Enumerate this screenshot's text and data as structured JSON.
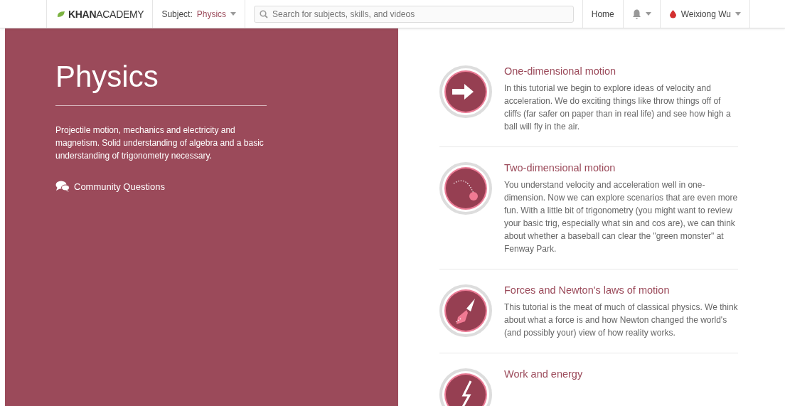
{
  "header": {
    "logo": "**KHAN**ACADEMY",
    "subject_label": "Subject:",
    "subject_value": "Physics",
    "search": {
      "placeholder": "Search for subjects, skills, and videos"
    },
    "home": "Home",
    "user": "Weixiong Wu"
  },
  "hero": {
    "title": "Physics",
    "description": "Projectile motion, mechanics and electricity and magnetism. Solid understanding of algebra and a basic understanding of trigonometry necessary.",
    "community_link": "Community Questions"
  },
  "tutorials": [
    {
      "kind": "arrow",
      "title": "One-dimensional motion",
      "description": "In this tutorial we begin to explore ideas of velocity and acceleration. We do exciting things like throw things off of cliffs (far safer on paper than in real life) and see how high a ball will fly in the air."
    },
    {
      "kind": "trajectory",
      "title": "Two-dimensional motion",
      "description": "You understand velocity and acceleration well in one-dimension. Now we can explore scenarios that are even more fun. With a little bit of trigonometry (you might want to review your basic trig, especially what sin and cos are), we can think about whether a baseball can clear the \"green monster\" at Fenway Park."
    },
    {
      "kind": "rocket",
      "title": "Forces and Newton's laws of motion",
      "description": "This tutorial is the meat of much of classical physics. We think about what a force is and how Newton changed the world's (and possibly your) view of how reality works."
    },
    {
      "kind": "energy",
      "title": "Work and energy"
    }
  ]
}
